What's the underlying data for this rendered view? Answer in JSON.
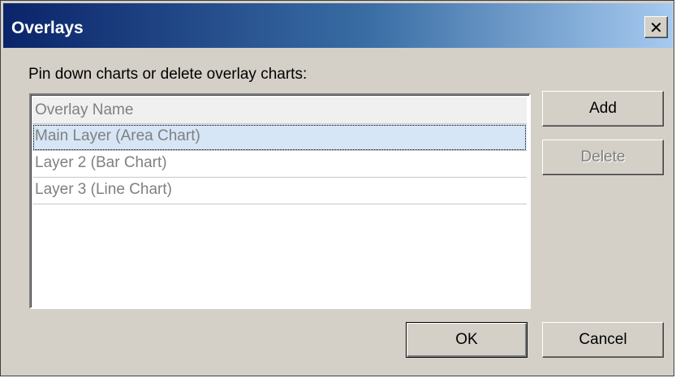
{
  "window": {
    "title": "Overlays",
    "close_glyph": "✕"
  },
  "prompt": "Pin down charts or delete overlay charts:",
  "list": {
    "header": "Overlay Name",
    "rows": [
      {
        "label": "Main Layer (Area Chart)",
        "selected": true
      },
      {
        "label": "Layer 2 (Bar Chart)",
        "selected": false
      },
      {
        "label": "Layer 3 (Line Chart)",
        "selected": false
      }
    ]
  },
  "buttons": {
    "add": "Add",
    "delete": "Delete",
    "ok": "OK",
    "cancel": "Cancel"
  },
  "icons": {
    "close": "close-icon"
  },
  "colors": {
    "titlebar_start": "#0a246a",
    "titlebar_end": "#a6caf0",
    "dialog_bg": "#d4d0c8",
    "selection_bg": "#d6e6f6"
  }
}
